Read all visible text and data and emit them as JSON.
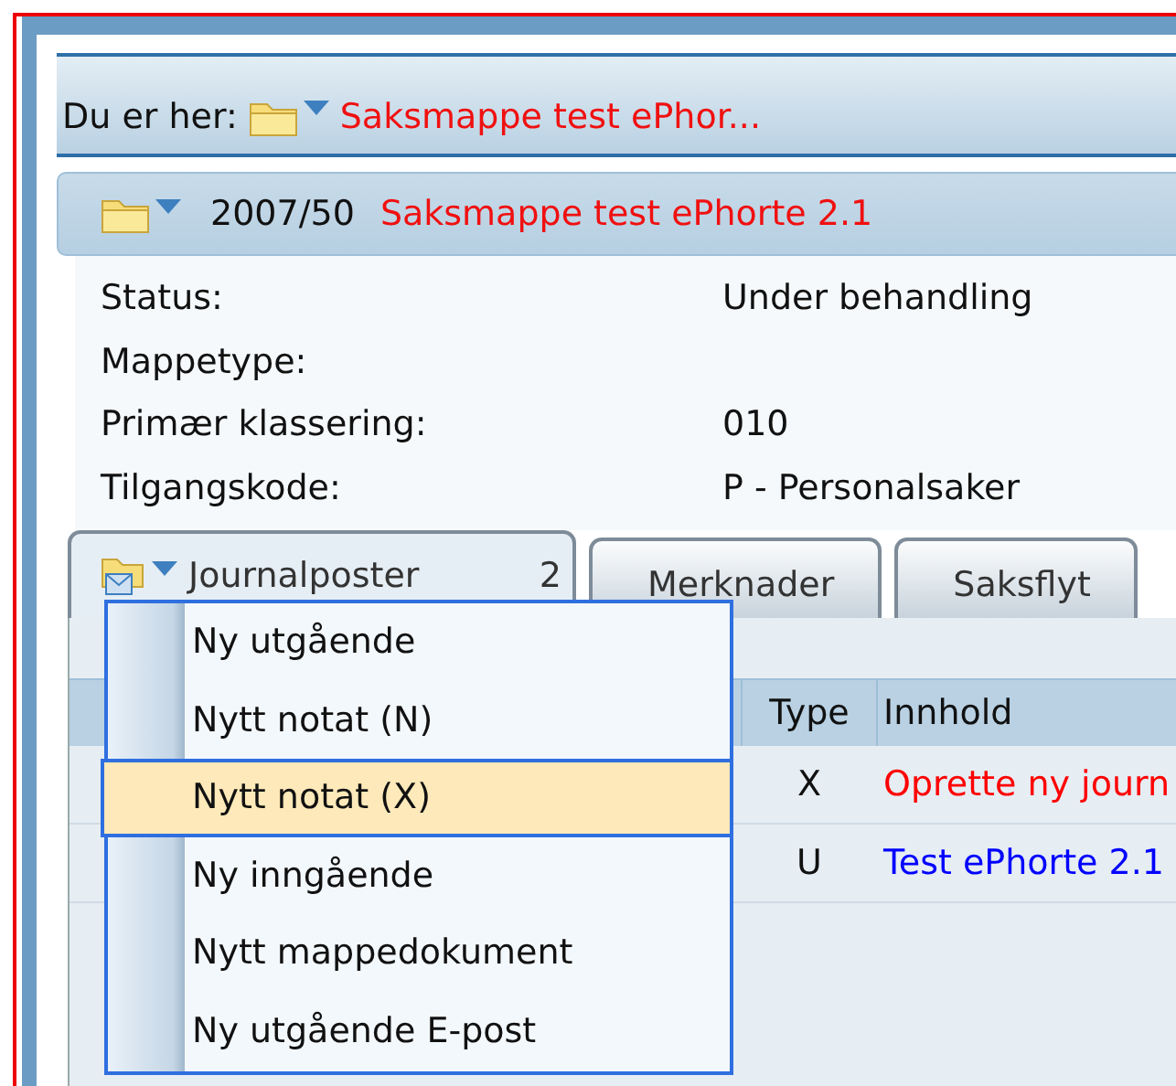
{
  "breadcrumb": {
    "label": "Du er her:",
    "link": "Saksmappe test ePhor..."
  },
  "case": {
    "number": "2007/50",
    "title": "Saksmappe test ePhorte 2.1"
  },
  "details": [
    {
      "label": "Status:",
      "value": "Under behandling"
    },
    {
      "label": "Mappetype:"
    },
    {
      "label": "Primær klassering:",
      "value": "010"
    },
    {
      "label": "Tilgangskode:",
      "value": "P - Personalsaker"
    }
  ],
  "tabs": [
    {
      "label": "Journalposter",
      "count": "2",
      "selected": true
    },
    {
      "label": "Merknader",
      "selected": false
    },
    {
      "label": "Saksflyt",
      "selected": false
    }
  ],
  "table": {
    "columns": [
      "Type",
      "Innhold"
    ],
    "rows": [
      {
        "type": "X",
        "content": "Oprette ny journ",
        "color": "#ff0000"
      },
      {
        "type": "U",
        "content": "Test ePhorte 2.1",
        "color": "#0000ff"
      }
    ]
  },
  "menu": {
    "items": [
      {
        "label": "Ny utgående",
        "selected": false
      },
      {
        "label": "Nytt notat (N)",
        "selected": false
      },
      {
        "label": "Nytt notat (X)",
        "selected": true
      },
      {
        "label": "Ny inngående",
        "selected": false
      },
      {
        "label": "Nytt mappedokument",
        "selected": false
      },
      {
        "label": "Ny utgående E-post",
        "selected": false
      }
    ]
  }
}
